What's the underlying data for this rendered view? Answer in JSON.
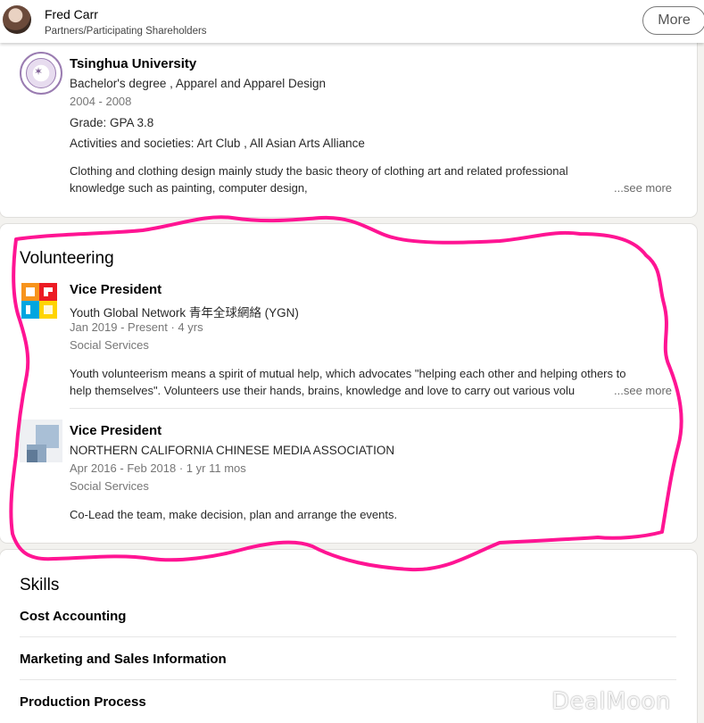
{
  "header": {
    "name": "Fred Carr",
    "title": "Partners/Participating Shareholders",
    "more_label": "More"
  },
  "education": {
    "school": "Tsinghua University",
    "degree": "Bachelor's degree , Apparel and Apparel Design",
    "dates": "2004 - 2008",
    "grade": "Grade: GPA 3.8",
    "activities": "Activities and societies: Art Club , All Asian Arts Alliance",
    "description_line1": "Clothing and clothing design mainly study the basic theory of clothing art and related professional",
    "description_line2": "knowledge such as painting, computer design,",
    "see_more": "...see more"
  },
  "volunteering": {
    "heading": "Volunteering",
    "items": [
      {
        "role": "Vice President",
        "org": "Youth Global Network 青年全球網絡 (YGN)",
        "dates": "Jan 2019 - Present · 4 yrs",
        "cause": "Social Services",
        "description_line1": "Youth volunteerism means a spirit of mutual help, which advocates \"helping each other and helping others to",
        "description_line2": "help themselves\". Volunteers use their hands, brains, knowledge and love to carry out various volu",
        "see_more": "...see more"
      },
      {
        "role": "Vice President",
        "org": "NORTHERN CALIFORNIA CHINESE MEDIA ASSOCIATION",
        "dates": "Apr 2016 - Feb 2018 · 1 yr 11 mos",
        "cause": "Social Services",
        "description_line1": "Co-Lead the team, make decision, plan and arrange the events."
      }
    ]
  },
  "skills": {
    "heading": "Skills",
    "items": [
      "Cost Accounting",
      "Marketing and Sales Information",
      "Production Process"
    ]
  },
  "watermark": "DealMoon",
  "colors": {
    "annotation": "#ff1493",
    "card_bg": "#ffffff",
    "page_bg": "#f3f2ef"
  }
}
